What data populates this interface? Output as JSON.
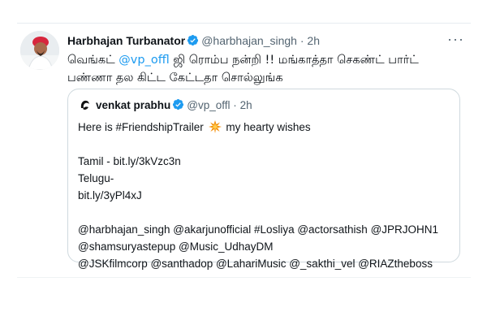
{
  "tweet": {
    "name": "Harbhajan Turbanator",
    "handle": "@harbhajan_singh",
    "separator": "·",
    "time": "2h",
    "more": "···",
    "text_part1": "வெங்கட் ",
    "text_mention": "@vp_offl",
    "text_part2": " ஜி ரொம்ப நன்றி !! மங்காத்தா செகண்ட் பார்ட் பண்ணா தல கிட்ட கேட்டதா சொல்லுங்க"
  },
  "quote": {
    "name": "venkat prabhu",
    "handle": "@vp_offl",
    "separator": "·",
    "time": "2h",
    "line1_a": "Here is #FriendshipTrailer",
    "line1_b": "my hearty wishes",
    "tamil": "Tamil - bit.ly/3kVzc3n",
    "telugu": "Telugu-",
    "telugu_link": "bit.ly/3yPl4xJ",
    "mentions1": "@harbhajan_singh @akarjunofficial #Losliya @actorsathish @JPRJOHN1",
    "mentions2": "@shamsuryastepup @Music_UdhayDM",
    "mentions3": "@JSKfilmcorp @santhadop @LahariMusic  @_sakthi_vel @RIAZtheboss"
  },
  "colors": {
    "accent": "#1d9bf0",
    "text": "#0f1419",
    "secondary": "#536471",
    "border": "#cfd9de"
  },
  "icons": {
    "verified": "verified-badge-icon",
    "spark": "collision-emoji-icon",
    "more": "more-options-icon"
  }
}
